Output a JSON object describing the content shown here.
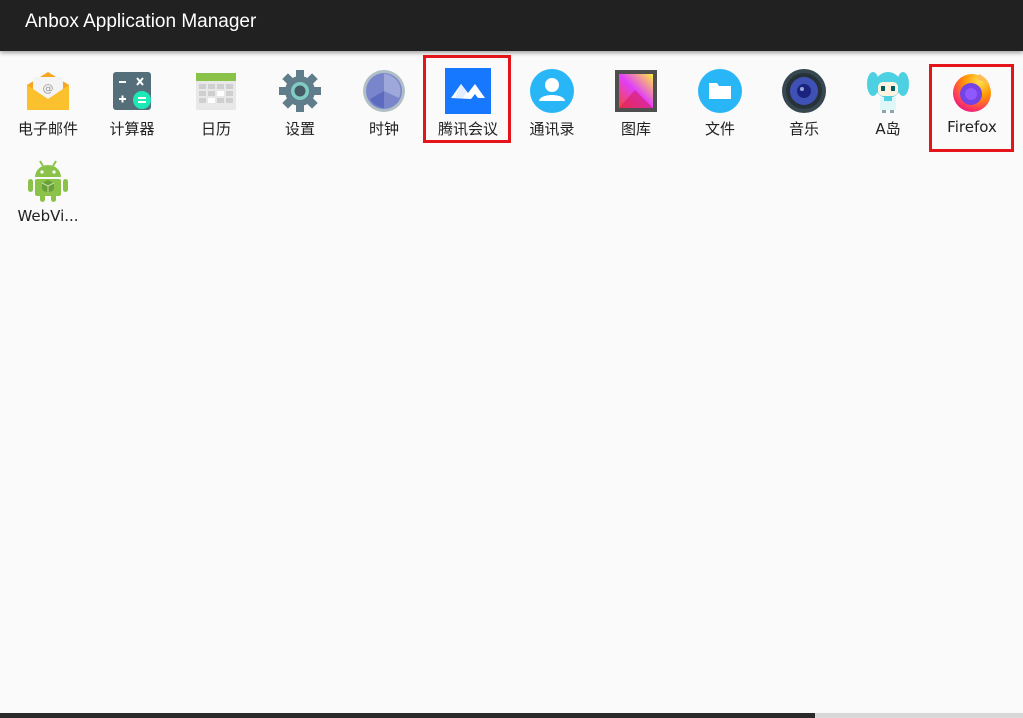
{
  "window": {
    "title": "Anbox Application Manager"
  },
  "apps": [
    {
      "label": "电子邮件",
      "icon": "email-envelope-icon"
    },
    {
      "label": "计算器",
      "icon": "calculator-icon"
    },
    {
      "label": "日历",
      "icon": "calendar-icon"
    },
    {
      "label": "设置",
      "icon": "gear-icon"
    },
    {
      "label": "时钟",
      "icon": "clock-icon"
    },
    {
      "label": "腾讯会议",
      "icon": "tencent-meeting-icon",
      "highlighted": true
    },
    {
      "label": "通讯录",
      "icon": "contacts-person-icon"
    },
    {
      "label": "图库",
      "icon": "gallery-picture-icon"
    },
    {
      "label": "文件",
      "icon": "folder-icon"
    },
    {
      "label": "音乐",
      "icon": "speaker-music-icon"
    },
    {
      "label": "A岛",
      "icon": "anime-character-icon"
    },
    {
      "label": "Firefox",
      "icon": "firefox-icon",
      "highlighted": true
    },
    {
      "label": "WebVi...",
      "icon": "android-webview-icon"
    }
  ],
  "colors": {
    "titlebar": "#212121",
    "background": "#fafafa",
    "highlight": "#e5141b"
  }
}
